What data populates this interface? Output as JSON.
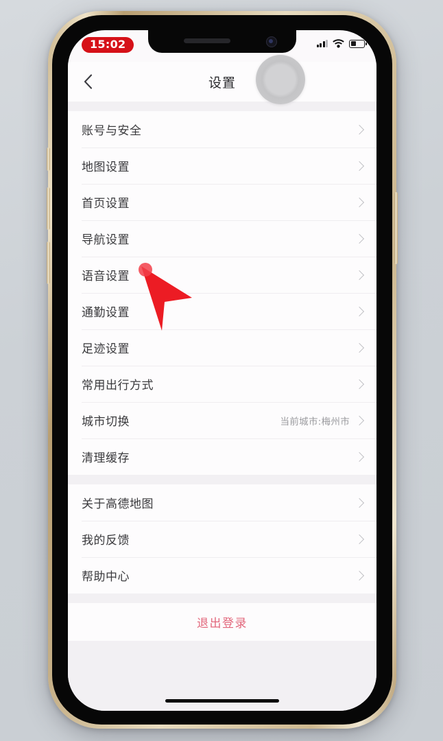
{
  "status_bar": {
    "time": "15:02",
    "signal_icon": "cellular-signal-icon",
    "wifi_icon": "wifi-icon",
    "battery_icon": "battery-low-icon"
  },
  "header": {
    "back_icon": "chevron-left-icon",
    "title": "设置",
    "assistive_touch": "assistive-touch-button"
  },
  "sections": [
    {
      "rows": [
        {
          "label": "账号与安全",
          "value": "",
          "chevron": "chevron-right-icon"
        },
        {
          "label": "地图设置",
          "value": "",
          "chevron": "chevron-right-icon"
        },
        {
          "label": "首页设置",
          "value": "",
          "chevron": "chevron-right-icon"
        },
        {
          "label": "导航设置",
          "value": "",
          "chevron": "chevron-right-icon"
        },
        {
          "label": "语音设置",
          "value": "",
          "chevron": "chevron-right-icon"
        },
        {
          "label": "通勤设置",
          "value": "",
          "chevron": "chevron-right-icon"
        },
        {
          "label": "足迹设置",
          "value": "",
          "chevron": "chevron-right-icon"
        },
        {
          "label": "常用出行方式",
          "value": "",
          "chevron": "chevron-right-icon"
        },
        {
          "label": "城市切换",
          "value": "当前城市:梅州市",
          "chevron": "chevron-right-icon"
        },
        {
          "label": "清理缓存",
          "value": "",
          "chevron": "chevron-right-icon"
        }
      ]
    },
    {
      "rows": [
        {
          "label": "关于高德地图",
          "value": "",
          "chevron": "chevron-right-icon"
        },
        {
          "label": "我的反馈",
          "value": "",
          "chevron": "chevron-right-icon"
        },
        {
          "label": "帮助中心",
          "value": "",
          "chevron": "chevron-right-icon"
        }
      ]
    }
  ],
  "logout": {
    "label": "退出登录"
  },
  "colors": {
    "time_badge_bg": "#d61118",
    "logout_text": "#e2677c",
    "row_label": "#3a3a3d",
    "row_value": "#9b9b9f",
    "group_bg": "#fdfcfd",
    "page_bg": "#f2f0f3",
    "cursor": "#ec1c24"
  },
  "cursor": {
    "icon": "mouse-pointer-arrow"
  }
}
